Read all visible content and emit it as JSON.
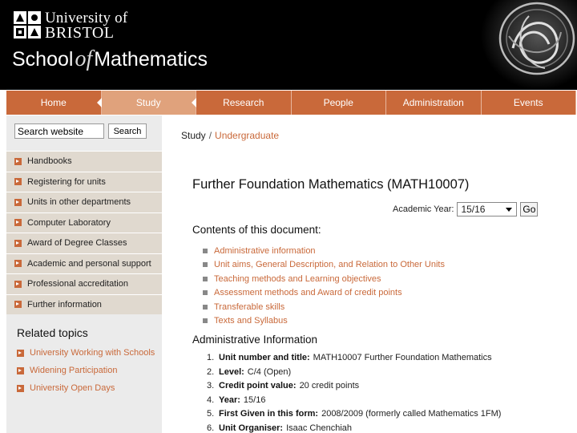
{
  "header": {
    "university_line1": "University of",
    "university_line2": "BRISTOL",
    "school_pre": "School",
    "school_of": "of",
    "school_post": "Mathematics"
  },
  "nav": {
    "items": [
      {
        "label": "Home"
      },
      {
        "label": "Study"
      },
      {
        "label": "Research"
      },
      {
        "label": "People"
      },
      {
        "label": "Administration"
      },
      {
        "label": "Events"
      }
    ],
    "active": "Study"
  },
  "sidebar": {
    "search_placeholder": "Search website",
    "search_button": "Search",
    "items": [
      {
        "label": "Handbooks"
      },
      {
        "label": "Registering for units"
      },
      {
        "label": "Units in other departments"
      },
      {
        "label": "Computer Laboratory"
      },
      {
        "label": "Award of Degree Classes"
      },
      {
        "label": "Academic and personal support"
      },
      {
        "label": "Professional accreditation"
      },
      {
        "label": "Further information"
      }
    ],
    "related_title": "Related topics",
    "related": [
      {
        "label": "University Working with Schools"
      },
      {
        "label": "Widening Participation"
      },
      {
        "label": "University Open Days"
      }
    ]
  },
  "breadcrumb": {
    "parent": "Study",
    "separator": "/",
    "current": "Undergraduate"
  },
  "main": {
    "title": "Further Foundation Mathematics (MATH10007)",
    "academic_year_label": "Academic Year:",
    "academic_year_value": "15/16",
    "go_label": "Go",
    "contents_heading": "Contents of this document:",
    "contents": [
      {
        "label": "Administrative information"
      },
      {
        "label": "Unit aims,   General Description, and Relation to Other Units"
      },
      {
        "label": "Teaching methods and Learning objectives"
      },
      {
        "label": "Assessment methods and Award of credit points"
      },
      {
        "label": "Transferable skills"
      },
      {
        "label": "Texts and Syllabus"
      }
    ],
    "admin_heading": "Administrative Information",
    "admin_items": [
      {
        "num": "1.",
        "label": "Unit number and title:",
        "value": "MATH10007 Further Foundation Mathematics"
      },
      {
        "num": "2.",
        "label": "Level:",
        "value": "C/4 (Open)"
      },
      {
        "num": "3.",
        "label": "Credit point value:",
        "value": "20 credit points"
      },
      {
        "num": "4.",
        "label": "Year:",
        "value": "15/16"
      },
      {
        "num": "5.",
        "label": "First Given in this form:",
        "value": "2008/2009 (formerly called Mathematics 1FM)"
      },
      {
        "num": "6.",
        "label": "Unit Organiser:",
        "value": "Isaac Chenchiah"
      }
    ]
  },
  "colors": {
    "accent": "#c9693a",
    "nav_active": "#e0a27c",
    "sidebar_bg": "#ebebeb",
    "menu_bg": "#e0d9cf",
    "header_bg": "#000000"
  }
}
